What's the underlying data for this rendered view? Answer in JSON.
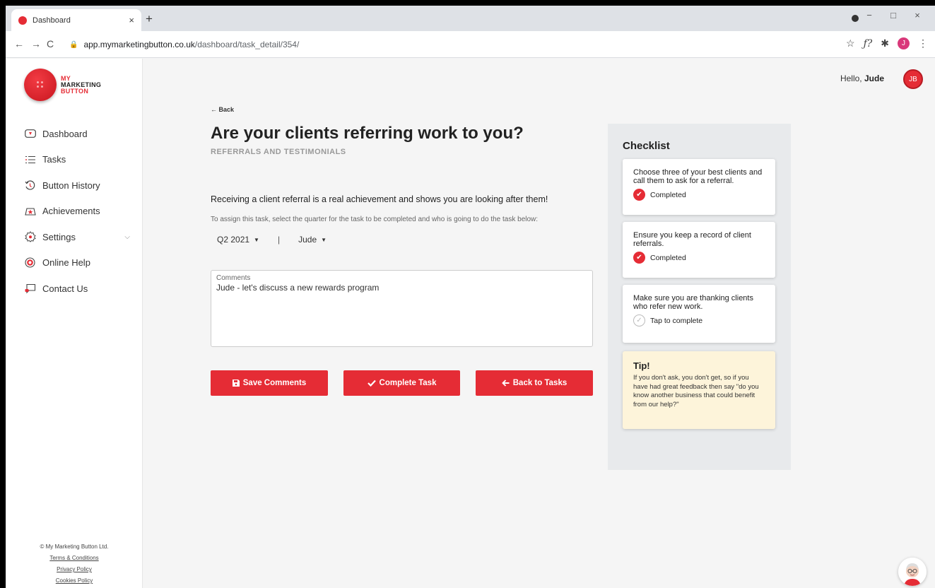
{
  "browser": {
    "tab_title": "Dashboard",
    "tab_close": "×",
    "new_tab": "+",
    "url_host": "app.mymarketingbutton.co.uk",
    "url_path": "/dashboard/task_detail/354/",
    "profile_initial": "J",
    "window_minimize": "−",
    "window_maximize": "□",
    "window_close": "×"
  },
  "brand": {
    "line1": "MY",
    "line2": "MARKETING",
    "line3": "BUTTON"
  },
  "sidebar": {
    "items": [
      {
        "label": "Dashboard",
        "icon": "dashboard-icon"
      },
      {
        "label": "Tasks",
        "icon": "tasks-icon"
      },
      {
        "label": "Button History",
        "icon": "history-icon"
      },
      {
        "label": "Achievements",
        "icon": "achievements-icon"
      },
      {
        "label": "Settings",
        "icon": "settings-icon",
        "chevron": "⌵"
      },
      {
        "label": "Online Help",
        "icon": "lifebuoy-icon"
      },
      {
        "label": "Contact Us",
        "icon": "chat-icon"
      }
    ],
    "footer": {
      "copyright": "© My Marketing Button Ltd.",
      "terms": "Terms & Conditions",
      "privacy": "Privacy Policy",
      "cookies": "Cookies Policy"
    }
  },
  "header": {
    "greeting": "Hello,",
    "user_name": "Jude",
    "user_initials": "JB"
  },
  "task": {
    "back_label": "← Back",
    "title": "Are your clients referring work to you?",
    "category": "REFERRALS AND TESTIMONIALS",
    "intro": "Receiving a client referral is a real achievement and shows you are looking after them!",
    "assign_instructions": "To assign this task, select the quarter for the task to be completed and who is going to do the task below:",
    "quarter": "Q2 2021",
    "separator": "|",
    "assignee": "Jude",
    "comments_label": "Comments",
    "comments_value": "Jude - let's discuss a new rewards program"
  },
  "actions": {
    "save": "Save Comments",
    "complete": "Complete Task",
    "back_to_tasks": "Back to Tasks"
  },
  "checklist": {
    "title": "Checklist",
    "items": [
      {
        "text": "Choose three of your best clients and call them to ask for a referral.",
        "status": "Completed",
        "done": true
      },
      {
        "text": "Ensure you keep a record of client referrals.",
        "status": "Completed",
        "done": true
      },
      {
        "text": "Make sure you are thanking clients who refer new work.",
        "status": "Tap to complete",
        "done": false
      }
    ],
    "tip_title": "Tip!",
    "tip_body": "If you don't ask, you don't get, so if you have had great feedback then say \"do you know another business that could benefit from our help?\""
  },
  "colors": {
    "brand_red": "#e52c35",
    "tip_bg": "#fdf4da",
    "checklist_bg": "#e8eaec"
  }
}
